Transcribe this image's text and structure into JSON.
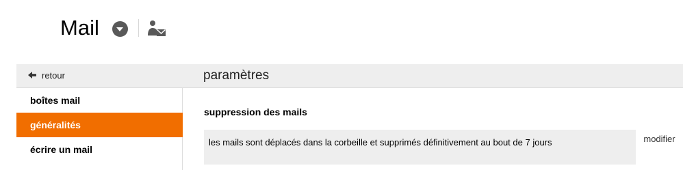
{
  "header": {
    "title": "Mail",
    "menu_icon": "chevron-down-circle-icon",
    "account_icon": "user-mail-icon"
  },
  "subbar": {
    "back_label": "retour",
    "back_icon": "arrow-left-icon",
    "page_title": "paramètres"
  },
  "sidebar": {
    "items": [
      {
        "label": "boîtes mail",
        "active": false
      },
      {
        "label": "généralités",
        "active": true
      },
      {
        "label": "écrire un mail",
        "active": false
      }
    ]
  },
  "main": {
    "section_title": "suppression des mails",
    "setting_value": "les mails sont déplacés dans la corbeille et supprimés définitivement au bout de 7 jours",
    "modify_label": "modifier"
  },
  "colors": {
    "accent": "#f16e00",
    "bar_background": "#eeeeee"
  }
}
